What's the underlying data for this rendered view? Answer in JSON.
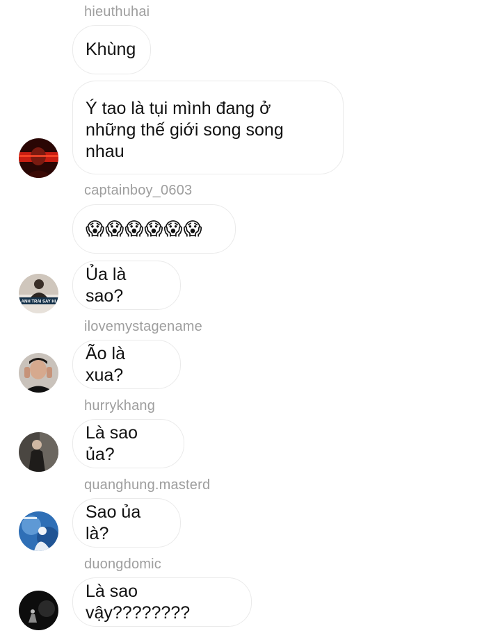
{
  "messages": [
    {
      "username": "hieuthuhai",
      "text": "Khùng"
    },
    {
      "username": "",
      "text": "Ý tao là tụi mình đang ở những thế giới song song nhau",
      "lines": [
        "Ý tao là tụi mình đang ở",
        "những thế giới song song",
        "nhau"
      ]
    },
    {
      "username": "captainboy_0603",
      "text": "😱😱😱😱😱😱"
    },
    {
      "username": "",
      "text": "Ủa là sao?"
    },
    {
      "username": "ilovemystagename",
      "text": "Ão là xua?"
    },
    {
      "username": "hurrykhang",
      "text": "Là sao ủa?"
    },
    {
      "username": "quanghung.masterd",
      "text": "Sao ủa là?"
    },
    {
      "username": "duongdomic",
      "text": "Là sao vậy????????"
    }
  ],
  "avatars": [
    {
      "icon": "red-portrait-avatar"
    },
    {
      "icon": "show-poster-avatar",
      "caption": "ANH TRAI SAY HI"
    },
    {
      "icon": "man-portrait-avatar"
    },
    {
      "icon": "dark-portrait-avatar"
    },
    {
      "icon": "blue-poster-avatar"
    },
    {
      "icon": "dark-stage-avatar"
    }
  ]
}
